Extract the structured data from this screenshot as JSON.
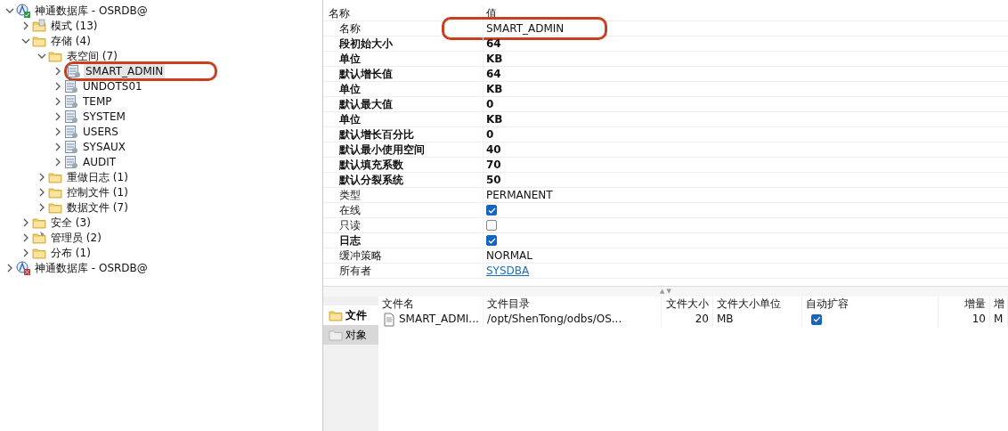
{
  "tree": [
    {
      "label": "神通数据库 - OSRDB@",
      "kind": "database",
      "connected": true,
      "expanded": true,
      "selected": false,
      "annotated": false,
      "children": [
        {
          "label": "模式 (13)",
          "kind": "schema",
          "expanded": false,
          "selected": false,
          "annotated": false
        },
        {
          "label": "存储 (4)",
          "kind": "folder",
          "expanded": true,
          "selected": false,
          "annotated": false,
          "children": [
            {
              "label": "表空间 (7)",
              "kind": "folder",
              "expanded": true,
              "selected": false,
              "annotated": false,
              "children": [
                {
                  "label": "SMART_ADMIN",
                  "kind": "tablespace",
                  "expanded": false,
                  "selected": true,
                  "annotated": true
                },
                {
                  "label": "UNDOTS01",
                  "kind": "tablespace",
                  "expanded": false,
                  "selected": false,
                  "annotated": false
                },
                {
                  "label": "TEMP",
                  "kind": "tablespace",
                  "expanded": false,
                  "selected": false,
                  "annotated": false
                },
                {
                  "label": "SYSTEM",
                  "kind": "tablespace",
                  "expanded": false,
                  "selected": false,
                  "annotated": false
                },
                {
                  "label": "USERS",
                  "kind": "tablespace",
                  "expanded": false,
                  "selected": false,
                  "annotated": false
                },
                {
                  "label": "SYSAUX",
                  "kind": "tablespace",
                  "expanded": false,
                  "selected": false,
                  "annotated": false
                },
                {
                  "label": "AUDIT",
                  "kind": "tablespace",
                  "expanded": false,
                  "selected": false,
                  "annotated": false
                }
              ]
            },
            {
              "label": "重做日志 (1)",
              "kind": "folder",
              "expanded": false,
              "selected": false,
              "annotated": false
            },
            {
              "label": "控制文件 (1)",
              "kind": "folder",
              "expanded": false,
              "selected": false,
              "annotated": false
            },
            {
              "label": "数据文件 (7)",
              "kind": "folder",
              "expanded": false,
              "selected": false,
              "annotated": false
            }
          ]
        },
        {
          "label": "安全 (3)",
          "kind": "folder",
          "expanded": false,
          "selected": false,
          "annotated": false
        },
        {
          "label": "管理员 (2)",
          "kind": "admin",
          "expanded": false,
          "selected": false,
          "annotated": false
        },
        {
          "label": "分布 (1)",
          "kind": "folder",
          "expanded": false,
          "selected": false,
          "annotated": false
        }
      ]
    },
    {
      "label": "神通数据库 - OSRDB@",
      "kind": "database",
      "connected": false,
      "expanded": false,
      "selected": false,
      "annotated": false
    }
  ],
  "properties": {
    "columns": [
      "名称",
      "值"
    ],
    "rows": [
      {
        "name": "名称",
        "value": "SMART_ADMIN",
        "kind": "text",
        "bold": false,
        "annotated": true
      },
      {
        "name": "段初始大小",
        "value": "64",
        "kind": "text",
        "bold": true,
        "annotated": false
      },
      {
        "name": "单位",
        "value": "KB",
        "kind": "text",
        "bold": true,
        "annotated": false
      },
      {
        "name": "默认增长值",
        "value": "64",
        "kind": "text",
        "bold": true,
        "annotated": false
      },
      {
        "name": "单位",
        "value": "KB",
        "kind": "text",
        "bold": true,
        "annotated": false
      },
      {
        "name": "默认最大值",
        "value": "0",
        "kind": "text",
        "bold": true,
        "annotated": false
      },
      {
        "name": "单位",
        "value": "KB",
        "kind": "text",
        "bold": true,
        "annotated": false
      },
      {
        "name": "默认增长百分比",
        "value": "0",
        "kind": "text",
        "bold": true,
        "annotated": false
      },
      {
        "name": "默认最小使用空间",
        "value": "40",
        "kind": "text",
        "bold": true,
        "annotated": false
      },
      {
        "name": "默认填充系数",
        "value": "70",
        "kind": "text",
        "bold": true,
        "annotated": false
      },
      {
        "name": "默认分裂系统",
        "value": "50",
        "kind": "text",
        "bold": true,
        "annotated": false
      },
      {
        "name": "类型",
        "value": "PERMANENT",
        "kind": "text",
        "bold": false,
        "annotated": false
      },
      {
        "name": "在线",
        "checked": true,
        "kind": "checkbox",
        "bold": false,
        "annotated": false
      },
      {
        "name": "只读",
        "checked": false,
        "kind": "checkbox",
        "bold": false,
        "annotated": false
      },
      {
        "name": "日志",
        "checked": true,
        "kind": "checkbox",
        "bold": true,
        "annotated": false
      },
      {
        "name": "缓冲策略",
        "value": "NORMAL",
        "kind": "text",
        "bold": false,
        "annotated": false
      },
      {
        "name": "所有者",
        "value": "SYSDBA",
        "kind": "link",
        "bold": false,
        "annotated": false
      }
    ]
  },
  "splitter": {
    "up": "▲",
    "down": "▼"
  },
  "side_tabs": [
    {
      "label": "文件",
      "selected": true
    },
    {
      "label": "对象",
      "selected": false
    }
  ],
  "files": {
    "columns": [
      "文件名",
      "文件目录",
      "文件大小",
      "文件大小单位",
      "自动扩容",
      "增量",
      "增"
    ],
    "rows": [
      {
        "name": "SMART_ADMI...",
        "directory": "/opt/ShenTong/odbs/OS...",
        "size": "20",
        "unit": "MB",
        "auto_extend": true,
        "increment": "10",
        "column_7": "M"
      }
    ]
  }
}
